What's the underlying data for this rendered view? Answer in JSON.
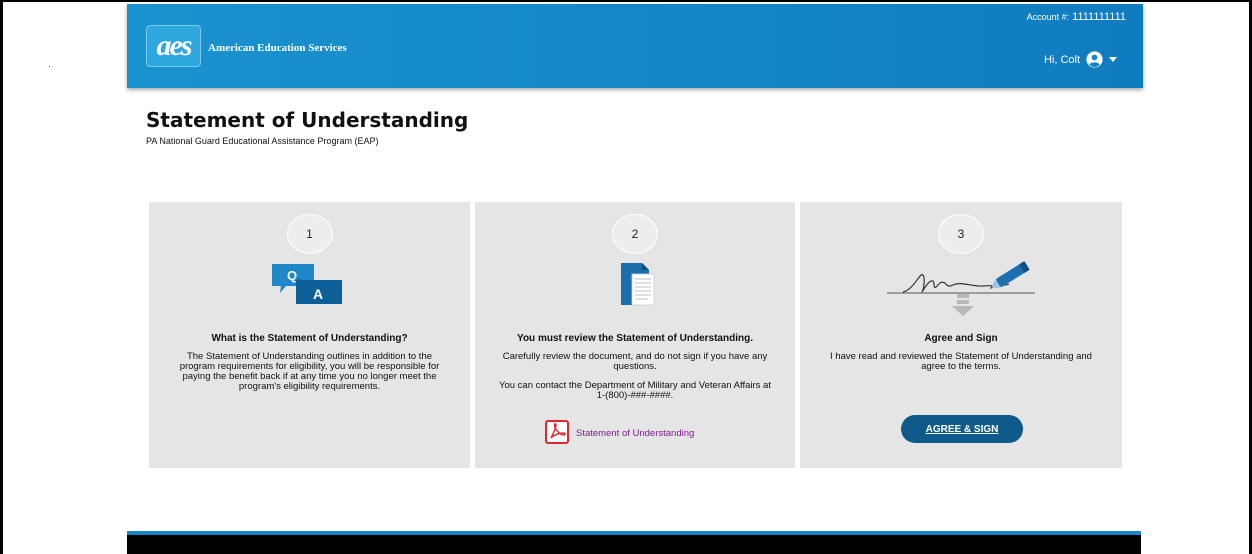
{
  "header": {
    "logo_text": "aes",
    "brand_name": "American Education Services",
    "account_label": "Account #:",
    "account_number": "1111111111",
    "greeting": "Hi, Colt"
  },
  "page": {
    "title": "Statement of Understanding",
    "subtitle": "PA National Guard Educational Assistance Program (EAP)"
  },
  "steps": [
    {
      "number": "1",
      "icon": "qa-chat-icon",
      "heading": "What is the Statement of Understanding?",
      "text": "The Statement of Understanding outlines in addition to the program requirements for eligibility, you will be responsible for paying the benefit back if at any time you no longer meet the program's eligibility requirements."
    },
    {
      "number": "2",
      "icon": "document-icon",
      "heading": "You must review the Statement of Understanding.",
      "text": "Carefully review the document, and do not sign if you have any questions.",
      "text2": "You can contact the Department of Military and Veteran Affairs at 1-(800)-###-####.",
      "link_label": "Statement of Understanding"
    },
    {
      "number": "3",
      "icon": "signature-pen-icon",
      "heading": "Agree and Sign",
      "text": "I have read and reviewed the Statement of Understanding and agree to the terms.",
      "button_label": "AGREE & SIGN"
    }
  ],
  "colors": {
    "header_blue": "#1487c6",
    "card_bg": "#e5e5e5",
    "button_blue": "#0e5a8a",
    "link_purple": "#7b1c8c",
    "pdf_red": "#e0272d",
    "footer_accent": "#1b86c7"
  }
}
